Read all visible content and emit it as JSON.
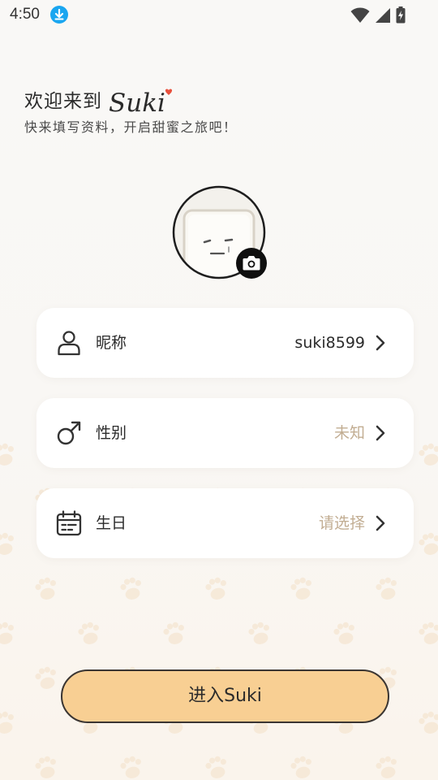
{
  "status_bar": {
    "time": "4:50",
    "left_icons": [
      "download-notification-icon"
    ],
    "right_icons": [
      "wifi-icon",
      "cell-signal-icon",
      "battery-charging-icon"
    ]
  },
  "header": {
    "welcome": "欢迎来到",
    "brand": "Suki",
    "subtitle": "快来填写资料，开启甜蜜之旅吧！"
  },
  "avatar": {
    "icon": "default-avatar-face",
    "camera_icon": "camera-icon"
  },
  "fields": [
    {
      "icon": "person-icon",
      "label": "昵称",
      "value": "suki8599",
      "filled": true
    },
    {
      "icon": "male-gender-icon",
      "label": "性别",
      "value": "未知",
      "filled": false
    },
    {
      "icon": "calendar-icon",
      "label": "生日",
      "value": "请选择",
      "filled": false
    }
  ],
  "enter_button": {
    "label": "进入Suki"
  },
  "colors": {
    "accent": "#f8cf93",
    "placeholder": "#c2ad92",
    "text": "#2b2b2b",
    "brand_dot": "#e8503c",
    "download_badge": "#1aa6f0"
  }
}
